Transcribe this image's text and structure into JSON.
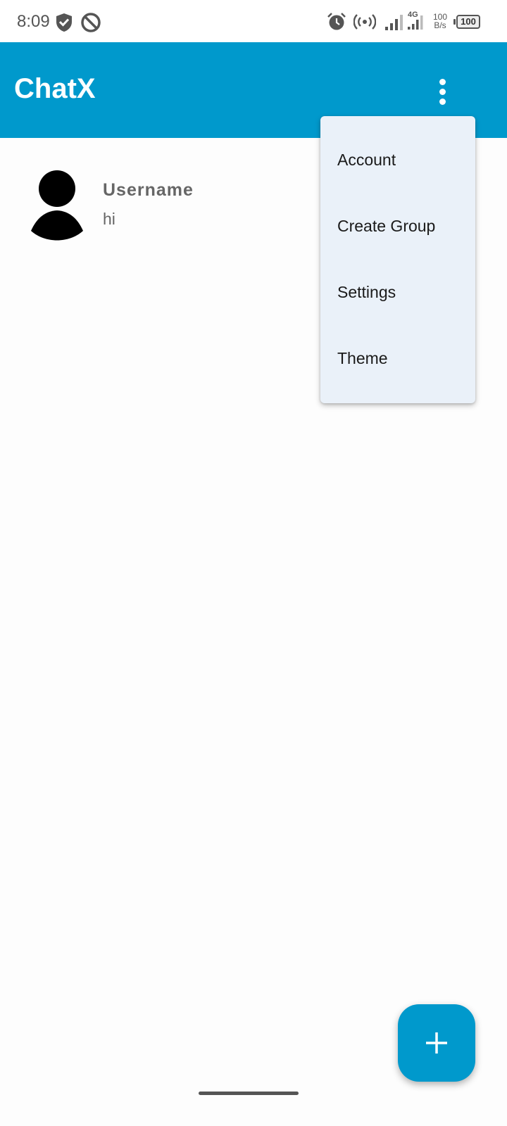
{
  "status_bar": {
    "time": "8:09",
    "speed_value": "100",
    "speed_unit": "B/s",
    "network_type": "4G",
    "battery": "100",
    "icons": [
      "shield-check-icon",
      "sync-blocked-icon",
      "alarm-icon",
      "hotspot-icon",
      "signal-icon",
      "signal-4g-icon",
      "battery-icon"
    ]
  },
  "app_bar": {
    "title": "ChatX",
    "overflow_icon": "more-vert-icon"
  },
  "chats": [
    {
      "name": "Username",
      "message": "hi",
      "avatar_icon": "person-icon"
    }
  ],
  "menu": {
    "items": [
      {
        "label": "Account"
      },
      {
        "label": "Create Group"
      },
      {
        "label": "Settings"
      },
      {
        "label": "Theme"
      }
    ]
  },
  "fab": {
    "icon": "plus-icon"
  },
  "colors": {
    "primary": "#0099cc",
    "menu_bg": "#eaf1f9",
    "text_muted": "#666666"
  }
}
